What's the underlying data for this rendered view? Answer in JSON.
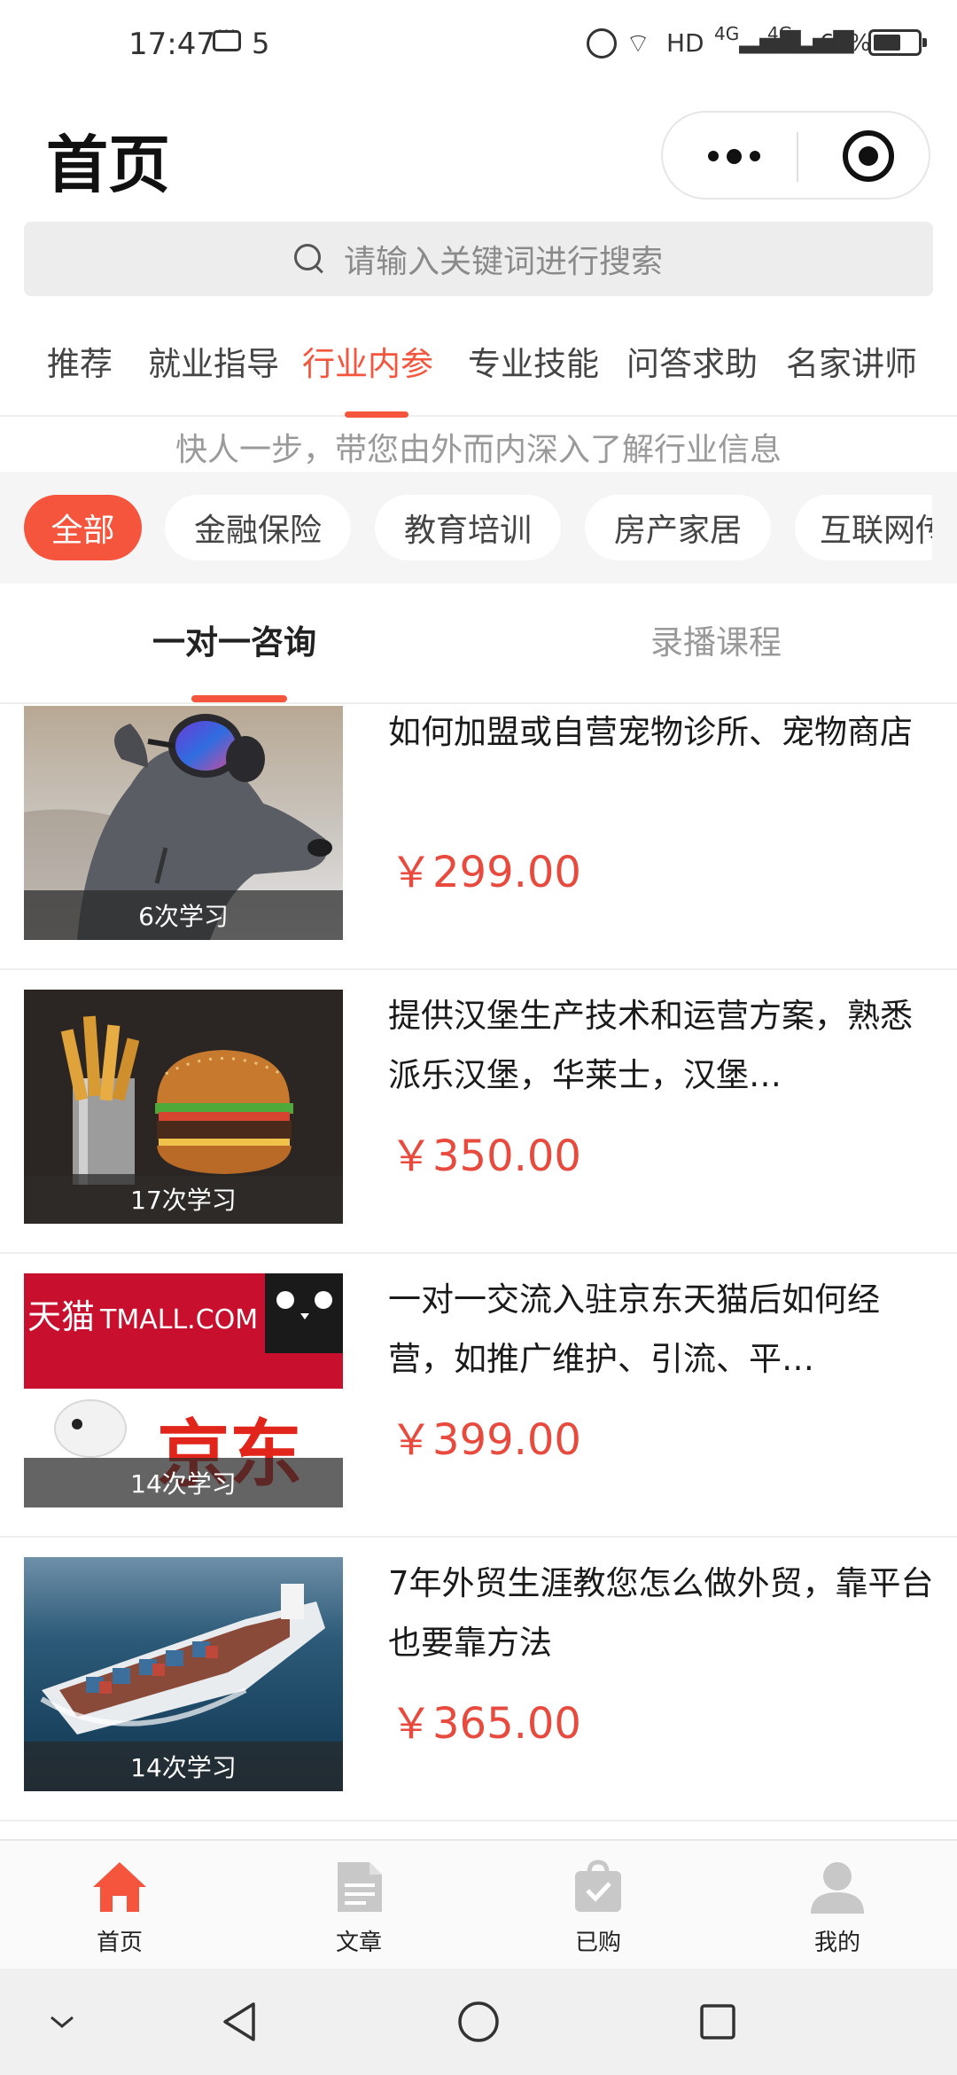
{
  "status_bar": {
    "time": "17:47",
    "notification_count": "5",
    "network": "HD",
    "signal1": "4G",
    "signal2": "4G",
    "battery": "63%",
    "battery_level": 0.63
  },
  "header": {
    "title": "首页"
  },
  "search": {
    "placeholder": "请输入关键词进行搜索"
  },
  "category_tabs": [
    {
      "label": "推荐",
      "active": false
    },
    {
      "label": "就业指导",
      "active": false
    },
    {
      "label": "行业内参",
      "active": true
    },
    {
      "label": "专业技能",
      "active": false
    },
    {
      "label": "问答求助",
      "active": false
    },
    {
      "label": "名家讲师",
      "active": false
    }
  ],
  "subtitle": "快人一步，带您由外而内深入了解行业信息",
  "filter_chips": [
    {
      "label": "全部",
      "active": true
    },
    {
      "label": "金融保险",
      "active": false
    },
    {
      "label": "教育培训",
      "active": false
    },
    {
      "label": "房产家居",
      "active": false
    },
    {
      "label": "互联网传",
      "active": false
    }
  ],
  "sub_tabs": [
    {
      "label": "一对一咨询",
      "active": true
    },
    {
      "label": "录播课程",
      "active": false
    }
  ],
  "courses": [
    {
      "title": "如何加盟或自营宠物诊所、宠物商店",
      "price": "￥299.00",
      "study_count": "6次学习",
      "image": "dog-goggles"
    },
    {
      "title": "提供汉堡生产技术和运营方案，熟悉派乐汉堡，华莱士，汉堡…",
      "price": "￥350.00",
      "study_count": "17次学习",
      "image": "burger-fries"
    },
    {
      "title": "一对一交流入驻京东天猫后如何经营，如推广维护、引流、平…",
      "price": "￥399.00",
      "study_count": "14次学习",
      "image": "tmall-jd",
      "image_text": {
        "tmall_cn": "天猫",
        "tmall_en": "TMALL.COM",
        "jd": "京东"
      }
    },
    {
      "title": "7年外贸生涯教您怎么做外贸，靠平台也要靠方法",
      "price": "￥365.00",
      "study_count": "14次学习",
      "image": "cargo-ship"
    }
  ],
  "bottom_nav": [
    {
      "label": "首页",
      "icon": "home-icon",
      "active": true
    },
    {
      "label": "文章",
      "icon": "article-icon",
      "active": false
    },
    {
      "label": "已购",
      "icon": "purchased-icon",
      "active": false
    },
    {
      "label": "我的",
      "icon": "profile-icon",
      "active": false
    }
  ],
  "colors": {
    "accent": "#f5553d",
    "price": "#e84a3d",
    "inactive_icon": "#c8c8c8"
  }
}
